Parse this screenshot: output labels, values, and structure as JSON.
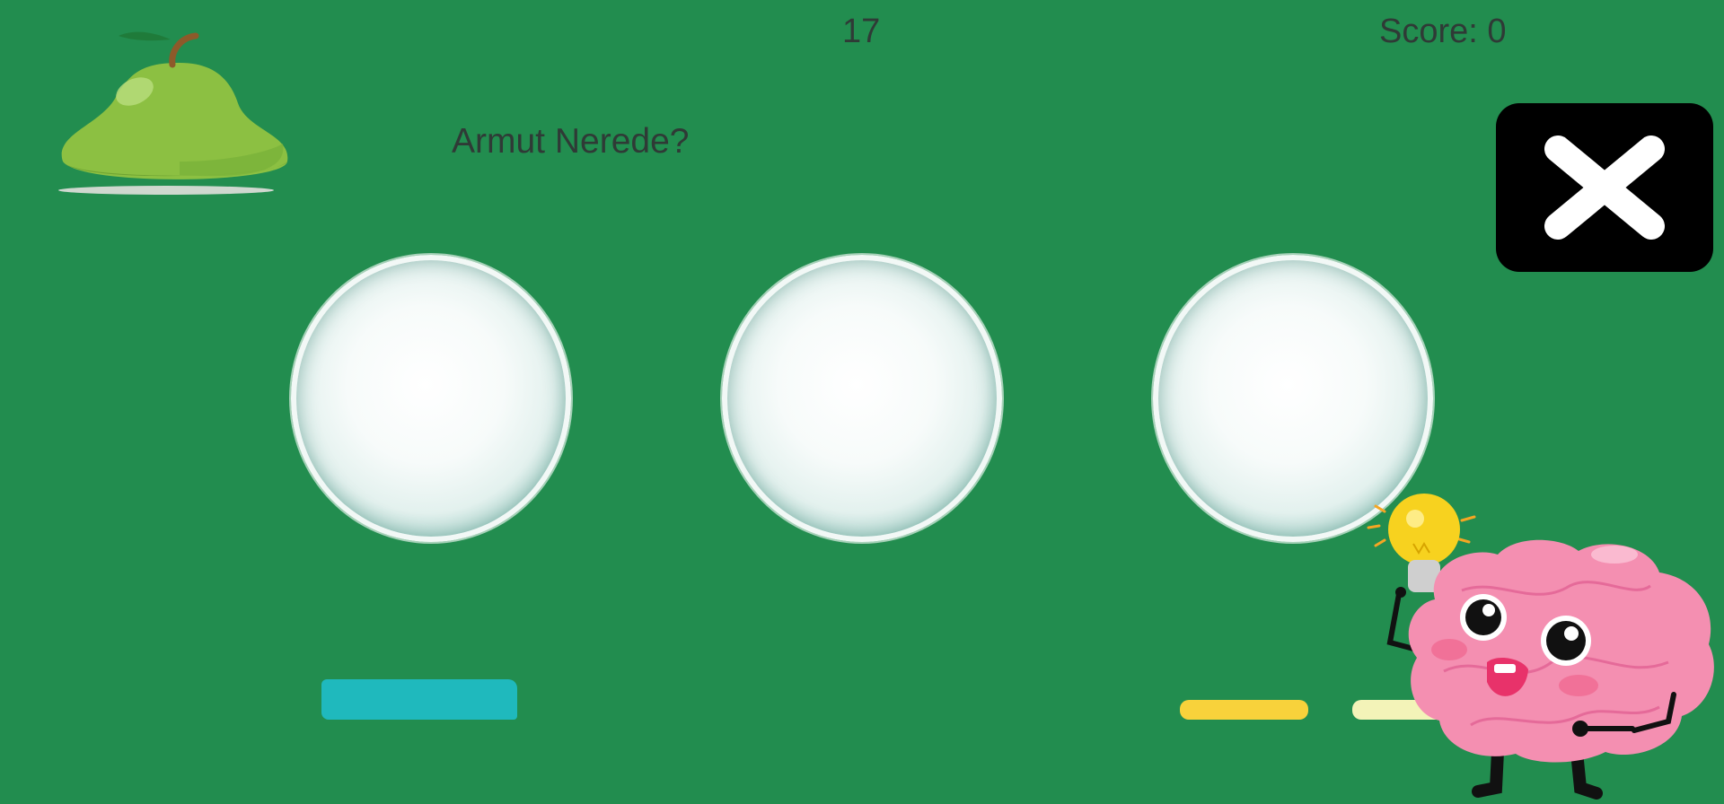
{
  "hud": {
    "timer": "17",
    "score": "Score: 0"
  },
  "question": "Armut Nerede?",
  "target_item_icon": "pear-icon",
  "close_button_icon": "close-x-icon",
  "bowls": [
    {
      "label": "bowl-1"
    },
    {
      "label": "bowl-2"
    },
    {
      "label": "bowl-3"
    }
  ],
  "colors": {
    "background": "#228d4f",
    "close_button": "#000000",
    "bar_teal": "#1fb9bd",
    "bar_yellow": "#f8d23b",
    "bar_cream": "#f3f3b8",
    "text": "#2f3a36"
  },
  "mascot_icon": "brain-lightbulb-mascot"
}
